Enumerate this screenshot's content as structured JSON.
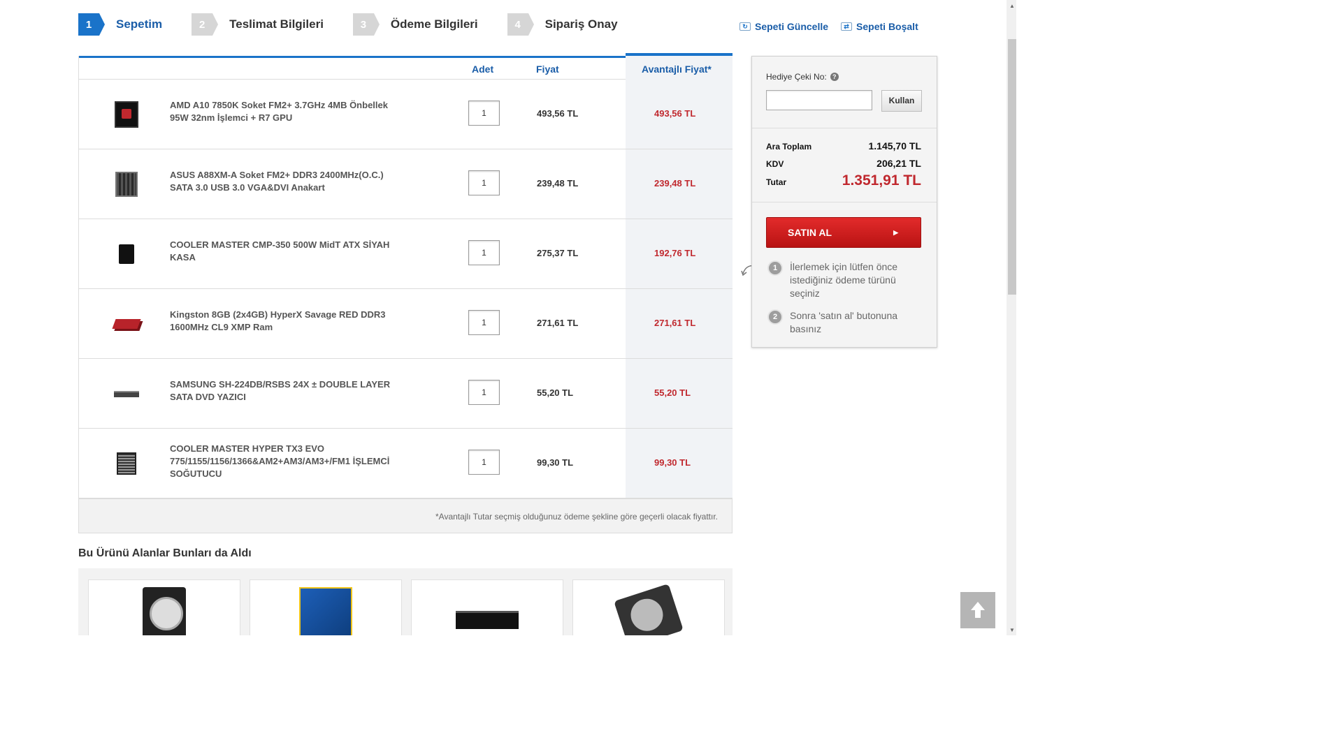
{
  "steps": [
    {
      "num": "1",
      "label": "Sepetim",
      "active": true
    },
    {
      "num": "2",
      "label": "Teslimat Bilgileri"
    },
    {
      "num": "3",
      "label": "Ödeme Bilgileri"
    },
    {
      "num": "4",
      "label": "Sipariş Onay"
    }
  ],
  "actions": {
    "update": "Sepeti Güncelle",
    "empty": "Sepeti Boşalt"
  },
  "table": {
    "headers": {
      "qty": "Adet",
      "price": "Fiyat",
      "adv_price": "Avantajlı Fiyat*"
    },
    "rows": [
      {
        "name": "AMD A10 7850K Soket FM2+ 3.7GHz 4MB Önbellek 95W 32nm İşlemci + R7 GPU",
        "qty": "1",
        "price": "493,56 TL",
        "adv": "493,56 TL",
        "icon": "cpu-box-icon"
      },
      {
        "name": "ASUS A88XM-A Soket FM2+ DDR3 2400MHz(O.C.) SATA 3.0 USB 3.0 VGA&DVI Anakart",
        "qty": "1",
        "price": "239,48 TL",
        "adv": "239,48 TL",
        "icon": "motherboard-icon"
      },
      {
        "name": "COOLER MASTER CMP-350 500W MidT ATX SİYAH KASA",
        "qty": "1",
        "price": "275,37 TL",
        "adv": "192,76 TL",
        "icon": "pc-case-icon"
      },
      {
        "name": "Kingston 8GB (2x4GB) HyperX Savage RED DDR3 1600MHz CL9 XMP Ram",
        "qty": "1",
        "price": "271,61 TL",
        "adv": "271,61 TL",
        "icon": "ram-icon"
      },
      {
        "name": "SAMSUNG SH-224DB/RSBS 24X ± DOUBLE LAYER SATA DVD YAZICI",
        "qty": "1",
        "price": "55,20 TL",
        "adv": "55,20 TL",
        "icon": "dvd-drive-icon"
      },
      {
        "name": "COOLER MASTER HYPER TX3 EVO 775/1155/1156/1366&AM2+AM3/AM3+/FM1 İŞLEMCİ SOĞUTUCU",
        "qty": "1",
        "price": "99,30 TL",
        "adv": "99,30 TL",
        "icon": "cpu-cooler-icon"
      }
    ],
    "note": "*Avantajlı Tutar seçmiş olduğunuz ödeme şekline göre geçerli olacak fiyattır."
  },
  "summary": {
    "gift_label": "Hediye Çeki No:",
    "use_button": "Kullan",
    "subtotal_label": "Ara Toplam",
    "subtotal": "1.145,70 TL",
    "tax_label": "KDV",
    "tax": "206,21 TL",
    "total_label": "Tutar",
    "total": "1.351,91 TL",
    "buy_button": "SATIN AL",
    "hints": [
      {
        "num": "1",
        "text": "İlerlemek için lütfen önce istediğiniz ödeme türünü seçiniz"
      },
      {
        "num": "2",
        "text": "Sonra 'satın al' butonuna basınız"
      }
    ]
  },
  "related": {
    "title": "Bu Ürünü Alanlar Bunları da Aldı",
    "items": [
      {
        "icon": "hard-drive-icon"
      },
      {
        "icon": "intel-processor-box-icon"
      },
      {
        "icon": "optical-drive-icon"
      },
      {
        "icon": "hard-drive-open-icon"
      }
    ]
  },
  "colors": {
    "accent_blue": "#1a73c9",
    "price_red": "#c0282e",
    "buy_red": "#d42020"
  }
}
